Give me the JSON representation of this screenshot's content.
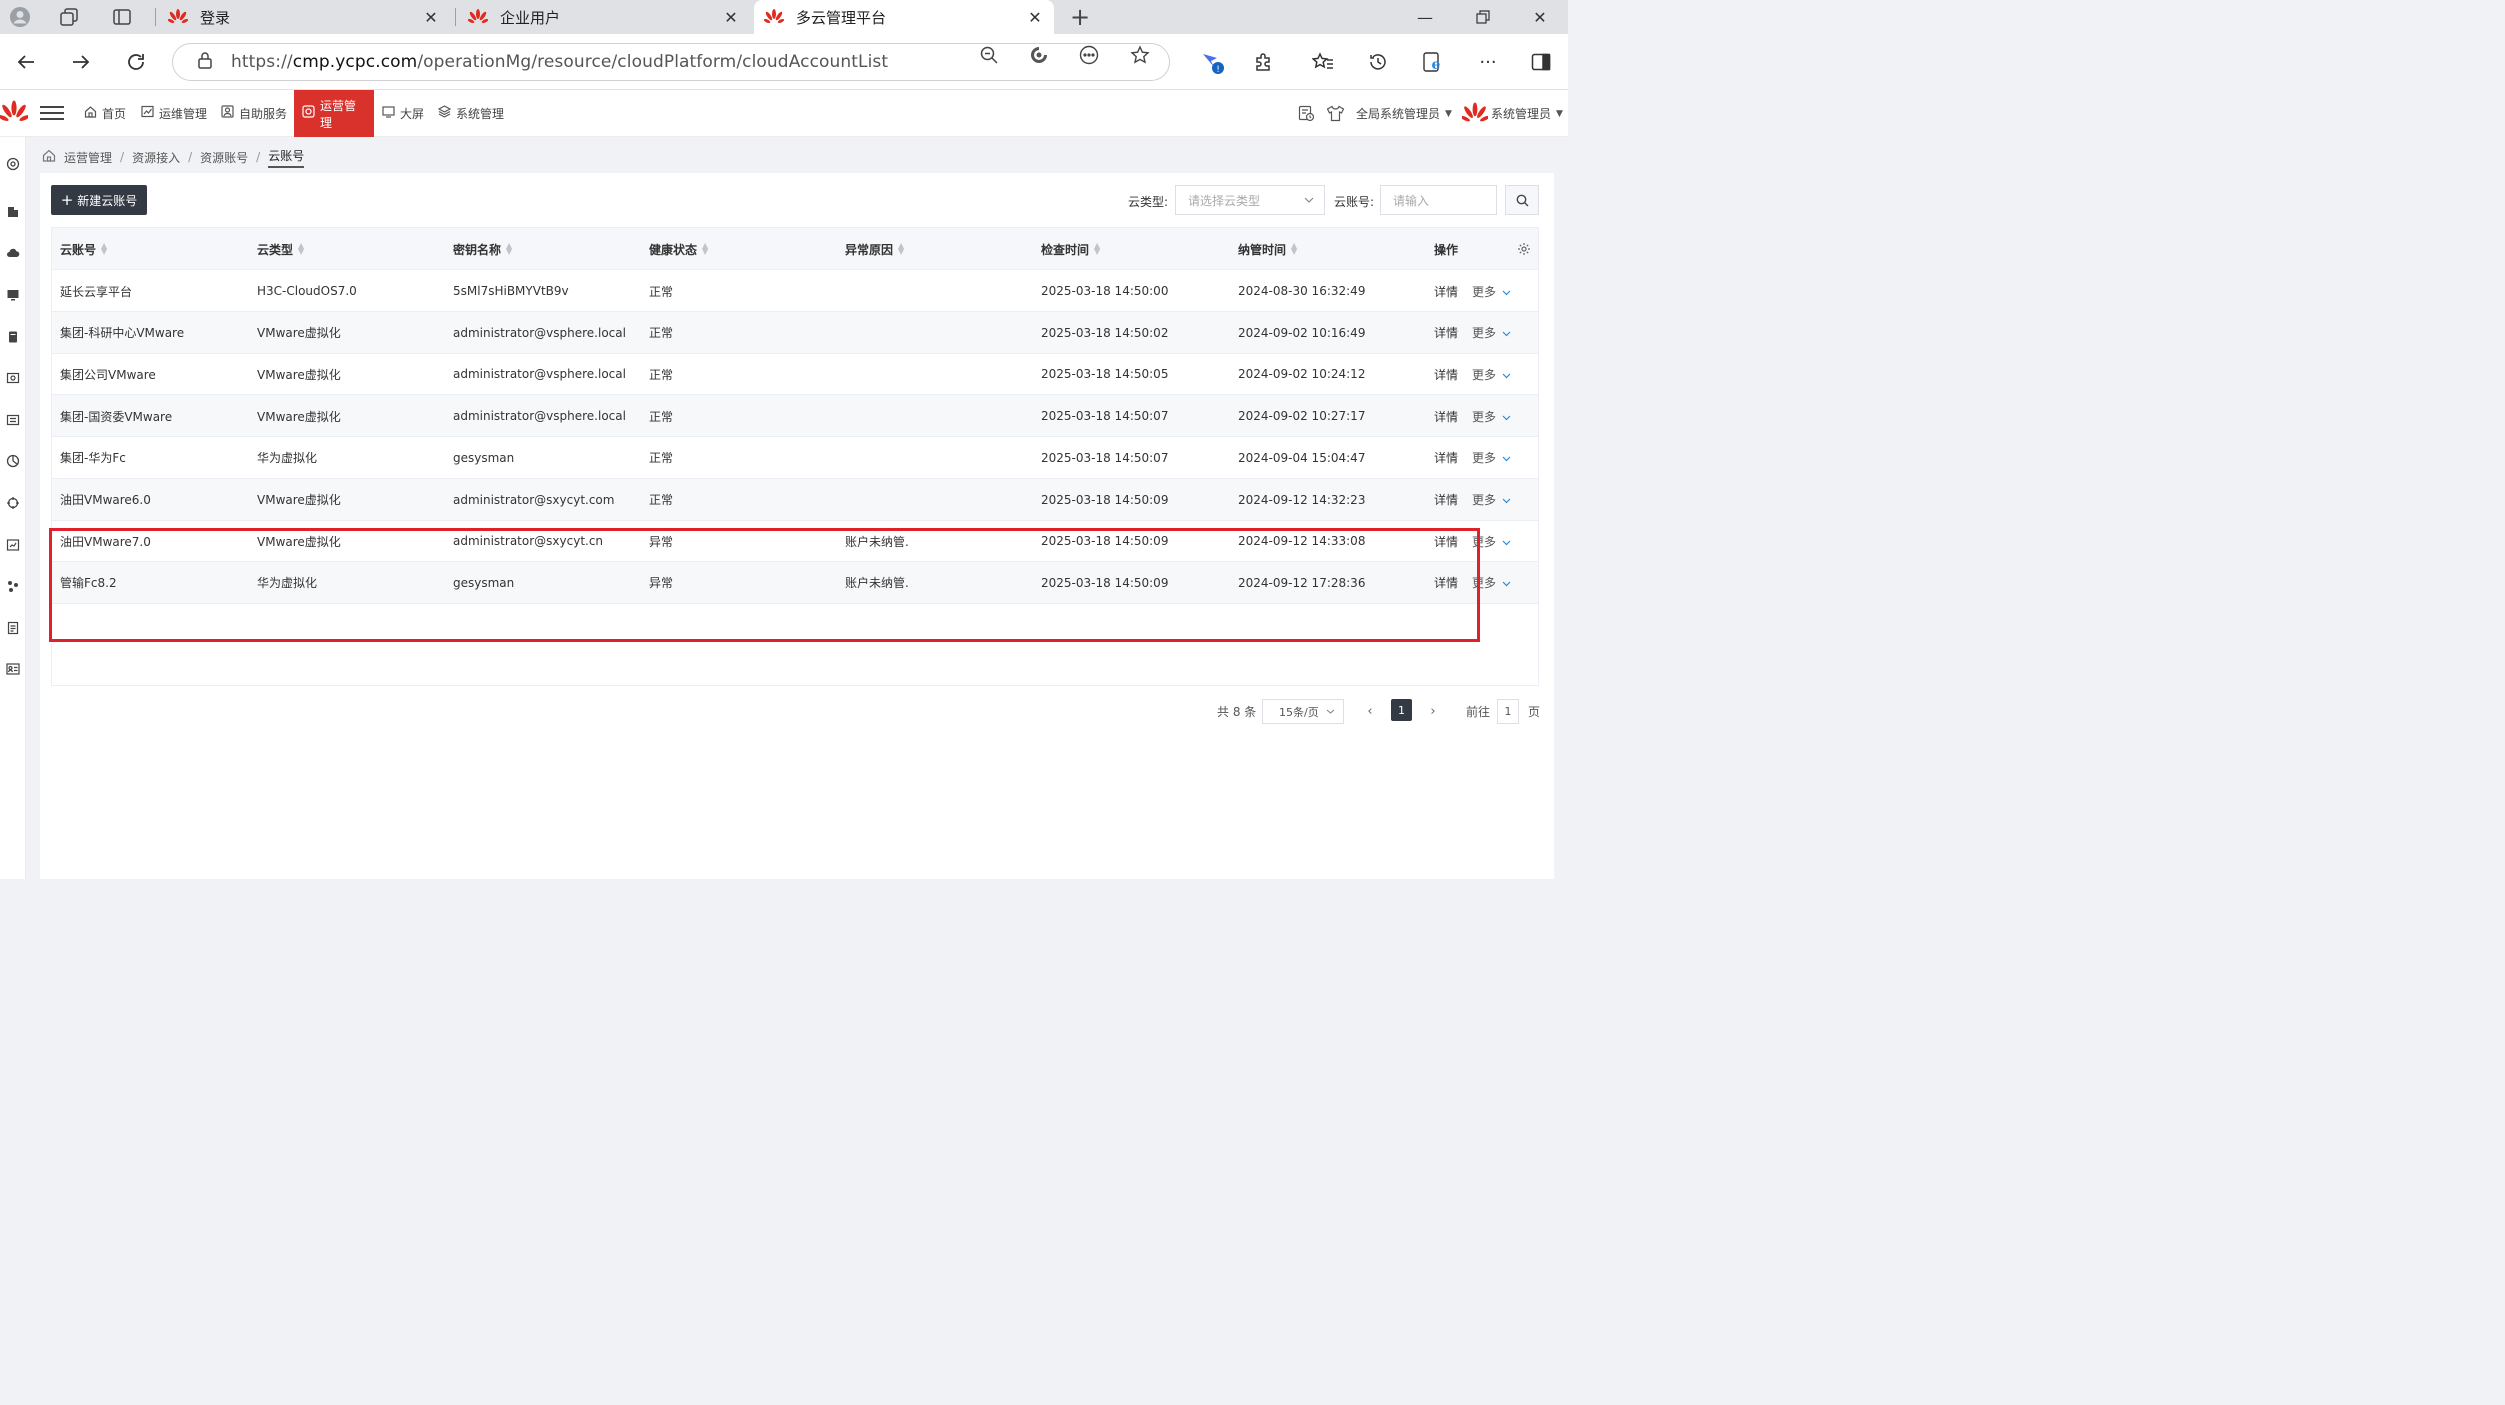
{
  "browser": {
    "tabs": [
      {
        "label": "登录"
      },
      {
        "label": "企业用户"
      },
      {
        "label": "多云管理平台"
      }
    ],
    "new_tab": "+",
    "url_prefix": "https://",
    "url_host": "cmp.ycpc.com",
    "url_path": "/operationMg/resource/cloudPlatform/cloudAccountList"
  },
  "nav": {
    "items": [
      {
        "label": "首页",
        "icon": "home-icon"
      },
      {
        "label": "运维管理",
        "icon": "chart-icon"
      },
      {
        "label": "自助服务",
        "icon": "user-card-icon"
      },
      {
        "label": "运营管理",
        "icon": "ops-icon"
      },
      {
        "label": "大屏",
        "icon": "screen-icon"
      },
      {
        "label": "系统管理",
        "icon": "layers-icon"
      }
    ],
    "role": "全局系统管理员",
    "user": "系统管理员"
  },
  "breadcrumb": [
    "运营管理",
    "资源接入",
    "资源账号",
    "云账号"
  ],
  "toolbar": {
    "new_button": "新建云账号",
    "filter_type_label": "云类型:",
    "filter_type_placeholder": "请选择云类型",
    "filter_account_label": "云账号:",
    "filter_account_placeholder": "请输入"
  },
  "table": {
    "columns": [
      "云账号",
      "云类型",
      "密钥名称",
      "健康状态",
      "异常原因",
      "检查时间",
      "纳管时间",
      "操作"
    ],
    "detail_label": "详情",
    "more_label": "更多",
    "rows": [
      {
        "account": "延长云享平台",
        "type": "H3C-CloudOS7.0",
        "key": "5sMl7sHiBMYVtB9v",
        "health": "正常",
        "reason": "",
        "checked": "2025-03-18 14:50:00",
        "managed": "2024-08-30 16:32:49"
      },
      {
        "account": "集团-科研中心VMware",
        "type": "VMware虚拟化",
        "key": "administrator@vsphere.local",
        "health": "正常",
        "reason": "",
        "checked": "2025-03-18 14:50:02",
        "managed": "2024-09-02 10:16:49"
      },
      {
        "account": "集团公司VMware",
        "type": "VMware虚拟化",
        "key": "administrator@vsphere.local",
        "health": "正常",
        "reason": "",
        "checked": "2025-03-18 14:50:05",
        "managed": "2024-09-02 10:24:12"
      },
      {
        "account": "集团-国资委VMware",
        "type": "VMware虚拟化",
        "key": "administrator@vsphere.local",
        "health": "正常",
        "reason": "",
        "checked": "2025-03-18 14:50:07",
        "managed": "2024-09-02 10:27:17"
      },
      {
        "account": "集团-华为Fc",
        "type": "华为虚拟化",
        "key": "gesysman",
        "health": "正常",
        "reason": "",
        "checked": "2025-03-18 14:50:07",
        "managed": "2024-09-04 15:04:47"
      },
      {
        "account": "油田VMware6.0",
        "type": "VMware虚拟化",
        "key": "administrator@sxycyt.com",
        "health": "正常",
        "reason": "",
        "checked": "2025-03-18 14:50:09",
        "managed": "2024-09-12 14:32:23"
      },
      {
        "account": "油田VMware7.0",
        "type": "VMware虚拟化",
        "key": "administrator@sxycyt.cn",
        "health": "异常",
        "reason": "账户未纳管.",
        "checked": "2025-03-18 14:50:09",
        "managed": "2024-09-12 14:33:08"
      },
      {
        "account": "管输Fc8.2",
        "type": "华为虚拟化",
        "key": "gesysman",
        "health": "异常",
        "reason": "账户未纳管.",
        "checked": "2025-03-18 14:50:09",
        "managed": "2024-09-12 17:28:36"
      }
    ]
  },
  "pagination": {
    "total": "共 8 条",
    "page_size": "15条/页",
    "current_page": "1",
    "goto_label": "前往",
    "goto_value": "1",
    "page_suffix": "页"
  },
  "colors": {
    "accent": "#d9312b",
    "primary_button": "#333a44",
    "highlight_box": "#e0202a"
  }
}
